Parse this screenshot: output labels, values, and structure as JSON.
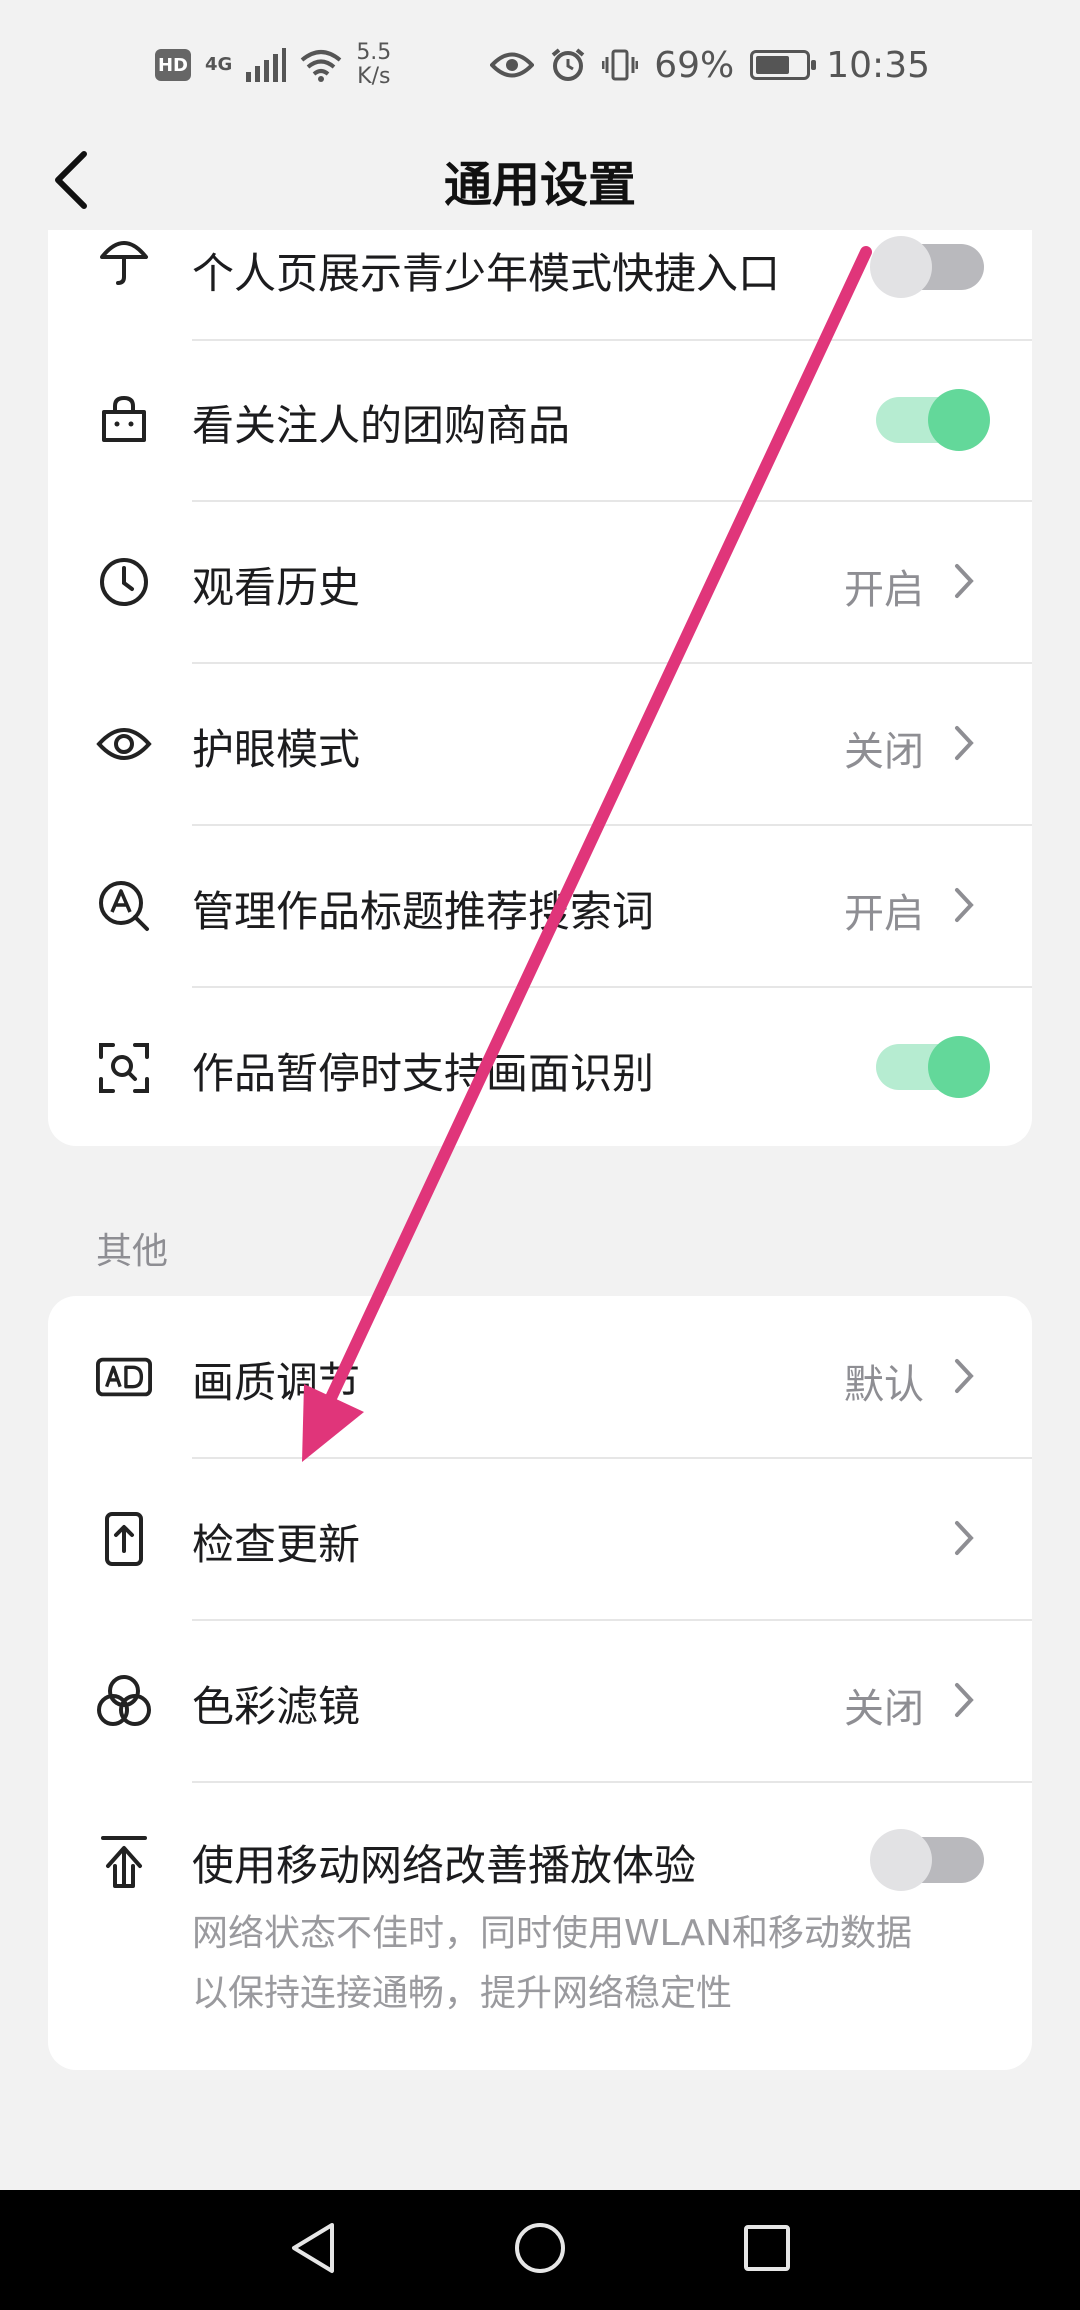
{
  "status_bar": {
    "hd": "HD",
    "network": "4G",
    "speed_value": "5.5",
    "speed_unit": "K/s",
    "battery_percent": "69%",
    "battery_level": 0.69,
    "time": "10:35"
  },
  "header": {
    "title": "通用设置"
  },
  "top_section": {
    "rows": [
      {
        "label": "个人页展示青少年模式快捷入口",
        "type": "toggle",
        "on": false,
        "icon": "umbrella-icon"
      },
      {
        "label": "看关注人的团购商品",
        "type": "toggle",
        "on": true,
        "icon": "shopping-bag-icon"
      },
      {
        "label": "观看历史",
        "type": "link",
        "value": "开启",
        "icon": "clock-icon"
      },
      {
        "label": "护眼模式",
        "type": "link",
        "value": "关闭",
        "icon": "eye-icon"
      },
      {
        "label": "管理作品标题推荐搜索词",
        "type": "link",
        "value": "开启",
        "icon": "search-a-icon"
      },
      {
        "label": "作品暂停时支持画面识别",
        "type": "toggle",
        "on": true,
        "icon": "scan-icon"
      }
    ]
  },
  "other_section": {
    "title": "其他",
    "rows": [
      {
        "label": "画质调节",
        "type": "link",
        "value": "默认",
        "icon": "ad-icon"
      },
      {
        "label": "检查更新",
        "type": "link",
        "value": "",
        "icon": "phone-update-icon"
      },
      {
        "label": "色彩滤镜",
        "type": "link",
        "value": "关闭",
        "icon": "color-filter-icon"
      },
      {
        "label": "使用移动网络改善播放体验",
        "type": "toggle",
        "on": false,
        "icon": "upload-icon",
        "desc_line1": "网络状态不佳时，同时使用WLAN和移动数据",
        "desc_line2": "以保持连接通畅，提升网络稳定性"
      }
    ]
  },
  "colors": {
    "toggle_on": "#63d89a",
    "toggle_off": "#b9b9bd",
    "annotation_arrow": "#e0357a"
  }
}
